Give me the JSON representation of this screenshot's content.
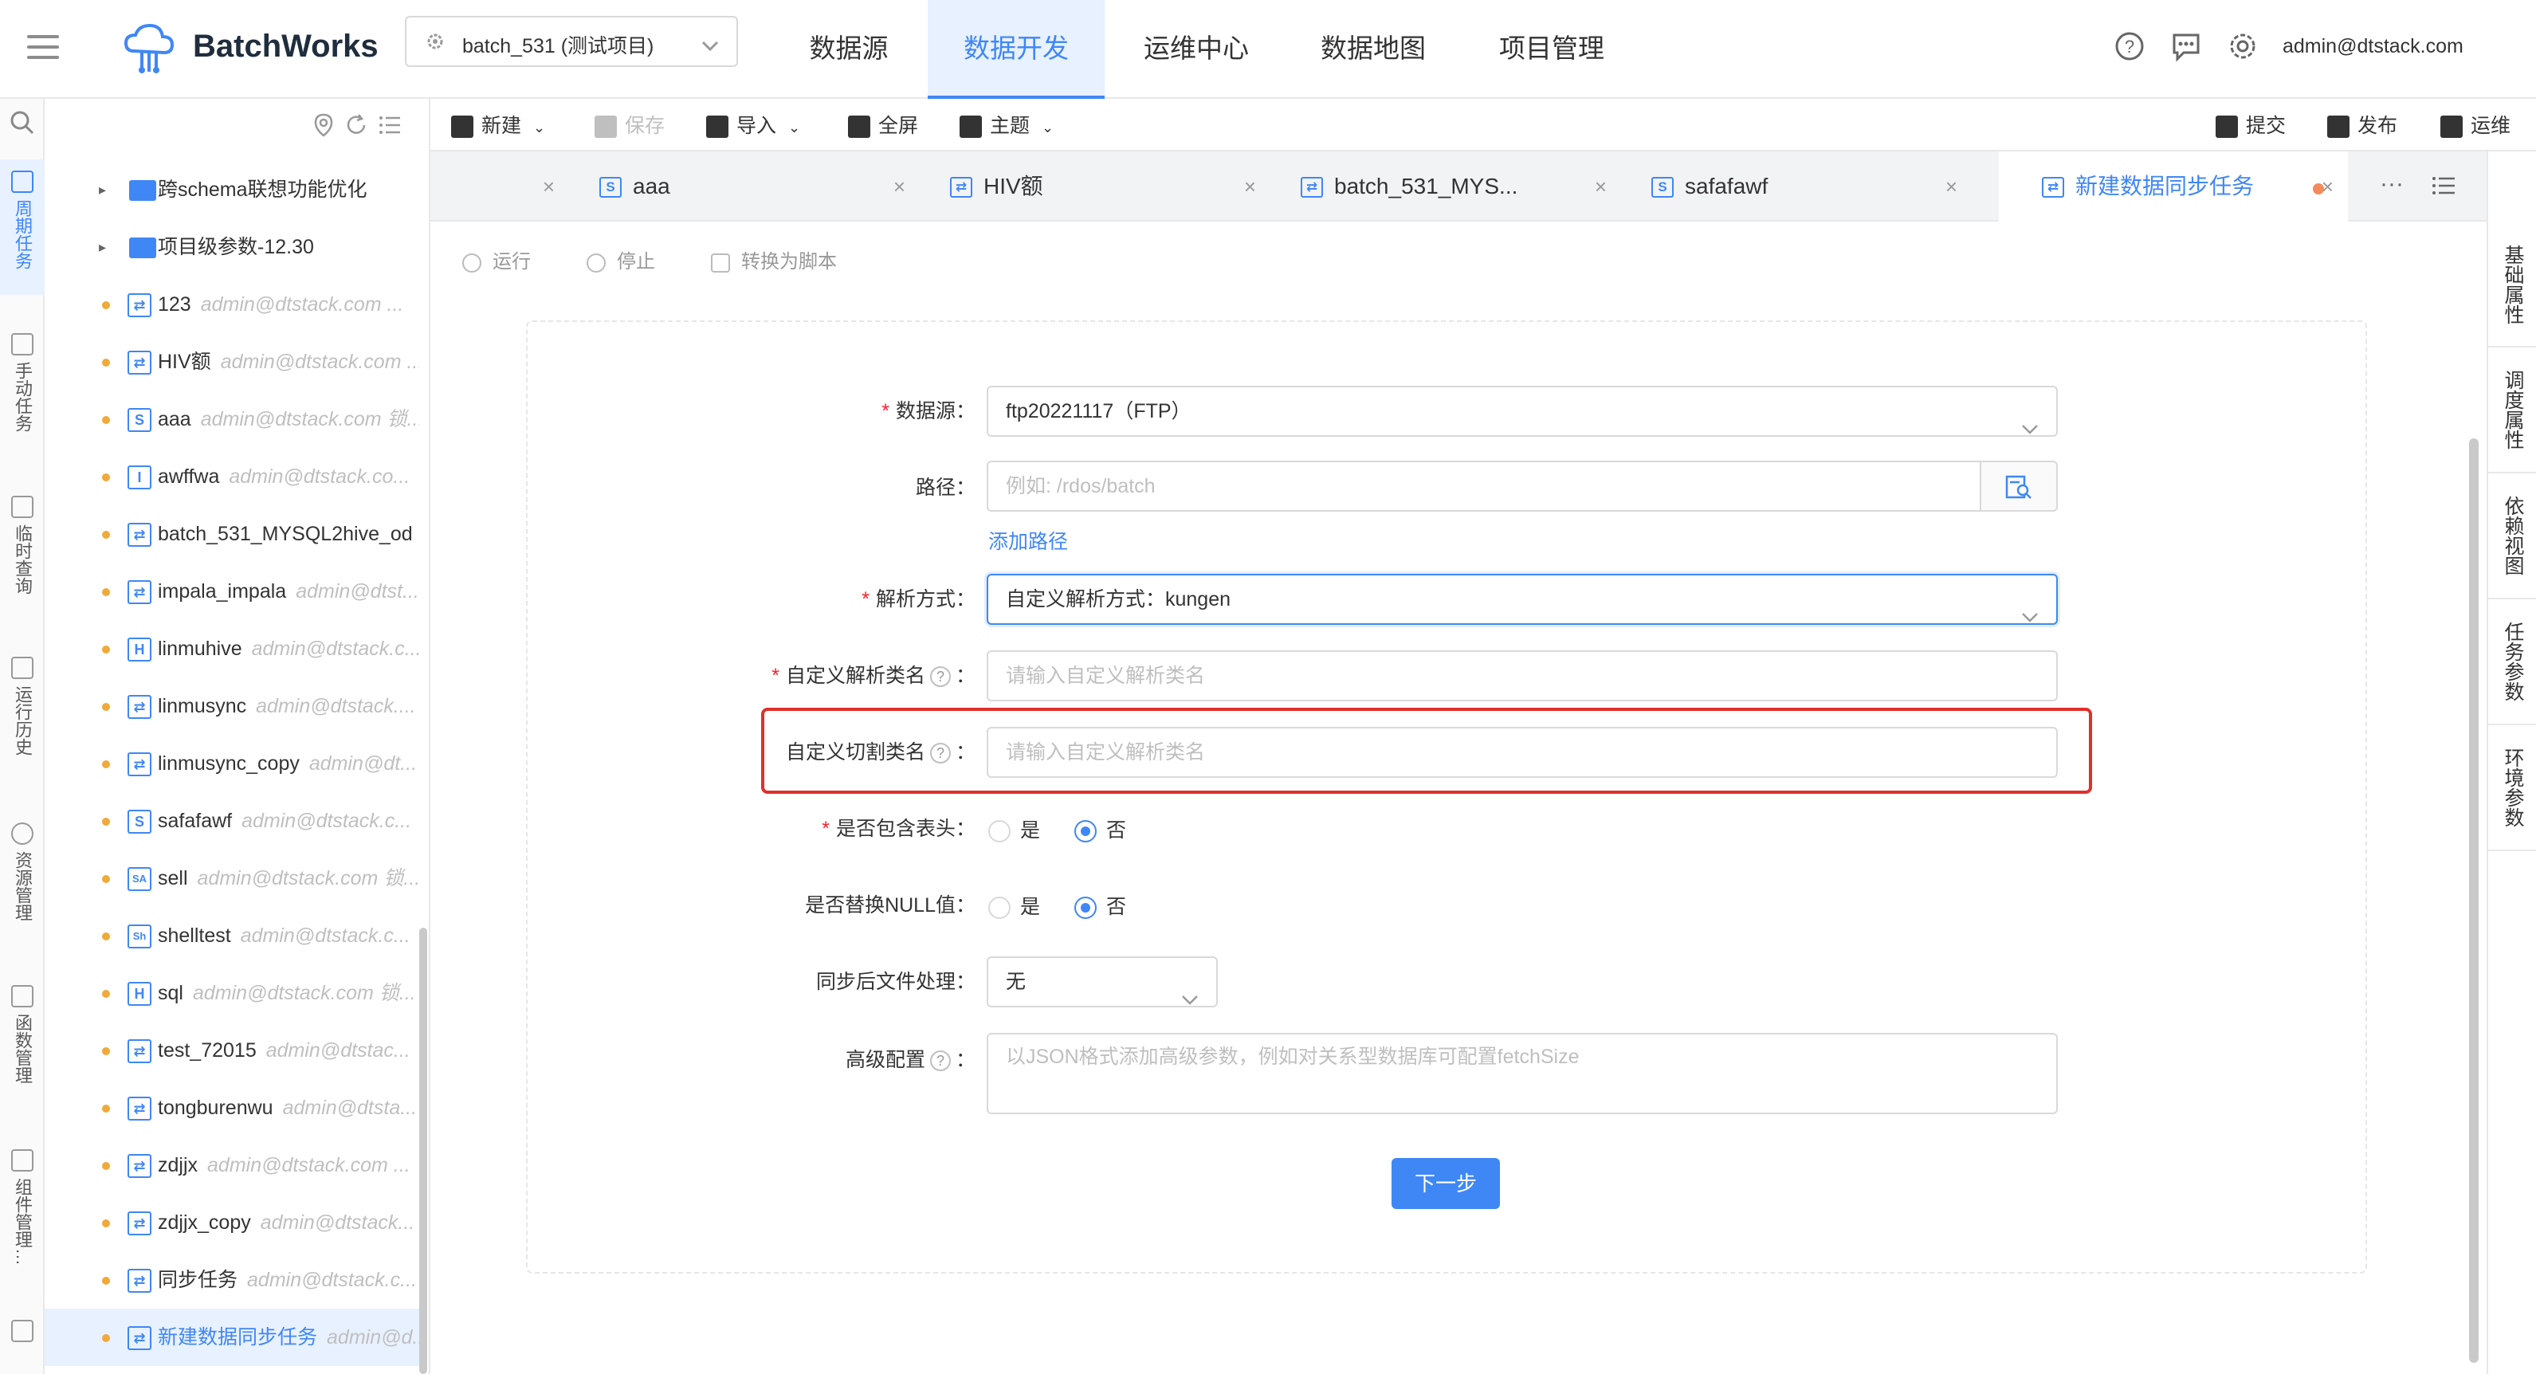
{
  "header": {
    "logo_text": "BatchWorks",
    "project": "batch_531 (测试项目)",
    "nav": [
      {
        "label": "数据源",
        "active": false
      },
      {
        "label": "数据开发",
        "active": true
      },
      {
        "label": "运维中心",
        "active": false
      },
      {
        "label": "数据地图",
        "active": false
      },
      {
        "label": "项目管理",
        "active": false
      }
    ],
    "user": "admin@dtstack.com"
  },
  "rail": [
    {
      "label": "周期任务",
      "icon": "calendar-icon",
      "active": true
    },
    {
      "label": "手动任务",
      "icon": "manual-task-icon",
      "active": false
    },
    {
      "label": "临时查询",
      "icon": "query-icon",
      "active": false
    },
    {
      "label": "运行历史",
      "icon": "history-icon",
      "active": false
    },
    {
      "label": "资源管理",
      "icon": "gear-icon",
      "active": false
    },
    {
      "label": "函数管理",
      "icon": "function-icon",
      "active": false
    },
    {
      "label": "组件管理…",
      "icon": "component-icon",
      "active": false
    }
  ],
  "tree": {
    "folders": [
      {
        "name": "跨schema联想功能优化"
      },
      {
        "name": "项目级参数-12.30"
      }
    ],
    "items": [
      {
        "type": "sync",
        "name": "123",
        "owner": "admin@dtstack.com ..."
      },
      {
        "type": "sync",
        "name": "HIV额",
        "owner": "admin@dtstack.com ..."
      },
      {
        "type": "S",
        "name": "aaa",
        "owner": "admin@dtstack.com 锁..."
      },
      {
        "type": "I",
        "name": "awffwa",
        "owner": "admin@dtstack.co..."
      },
      {
        "type": "sync",
        "name": "batch_531_MYSQL2hive_od",
        "owner": ""
      },
      {
        "type": "sync",
        "name": "impala_impala",
        "owner": "admin@dtst..."
      },
      {
        "type": "H",
        "name": "linmuhive",
        "owner": "admin@dtstack.c..."
      },
      {
        "type": "sync",
        "name": "linmusync",
        "owner": "admin@dtstack...."
      },
      {
        "type": "sync",
        "name": "linmusync_copy",
        "owner": "admin@dt..."
      },
      {
        "type": "S",
        "name": "safafawf",
        "owner": "admin@dtstack.c..."
      },
      {
        "type": "SA",
        "name": "sell",
        "owner": "admin@dtstack.com 锁..."
      },
      {
        "type": "Shell",
        "name": "shelltest",
        "owner": "admin@dtstack.c..."
      },
      {
        "type": "H",
        "name": "sql",
        "owner": "admin@dtstack.com 锁..."
      },
      {
        "type": "sync",
        "name": "test_72015",
        "owner": "admin@dtstac..."
      },
      {
        "type": "sync",
        "name": "tongburenwu",
        "owner": "admin@dtsta..."
      },
      {
        "type": "sync",
        "name": "zdjjx",
        "owner": "admin@dtstack.com ..."
      },
      {
        "type": "sync",
        "name": "zdjjx_copy",
        "owner": "admin@dtstack..."
      },
      {
        "type": "sync",
        "name": "同步任务",
        "owner": "admin@dtstack.c..."
      },
      {
        "type": "sync",
        "name": "新建数据同步任务",
        "owner": "admin@d..."
      }
    ]
  },
  "toolbar": {
    "new": "新建",
    "save": "保存",
    "import": "导入",
    "fullscreen": "全屏",
    "theme": "主题",
    "submit": "提交",
    "publish": "发布",
    "ops": "运维"
  },
  "tabs": [
    {
      "name": "aaa",
      "icon": "S"
    },
    {
      "name": "HIV额",
      "icon": "sync"
    },
    {
      "name": "batch_531_MYS...",
      "icon": "sync"
    },
    {
      "name": "safafawf",
      "icon": "S"
    },
    {
      "name": "新建数据同步任务",
      "icon": "sync",
      "active": true
    }
  ],
  "subbar": {
    "run": "运行",
    "stop": "停止",
    "to_script": "转换为脚本"
  },
  "form": {
    "datasource_label": "数据源",
    "datasource_value": "ftp20221117（FTP）",
    "path_label": "路径",
    "path_placeholder": "例如: /rdos/batch",
    "add_path": "添加路径",
    "parse_label": "解析方式",
    "parse_value": "自定义解析方式：kungen",
    "parse_class_label": "自定义解析类名",
    "parse_class_placeholder": "请输入自定义解析类名",
    "split_class_label": "自定义切割类名",
    "split_class_placeholder": "请输入自定义解析类名",
    "header_label": "是否包含表头",
    "null_label": "是否替换NULL值",
    "yes": "是",
    "no": "否",
    "post_label": "同步后文件处理",
    "post_value": "无",
    "advanced_label": "高级配置",
    "advanced_placeholder": "以JSON格式添加高级参数，例如对关系型数据库可配置fetchSize",
    "next": "下一步"
  },
  "side_tabs": [
    "基础属性",
    "调度属性",
    "依赖视图",
    "任务参数",
    "环境参数"
  ],
  "colors": {
    "accent": "#3f87f5",
    "highlight": "#e0302a",
    "required": "#f5222d"
  }
}
